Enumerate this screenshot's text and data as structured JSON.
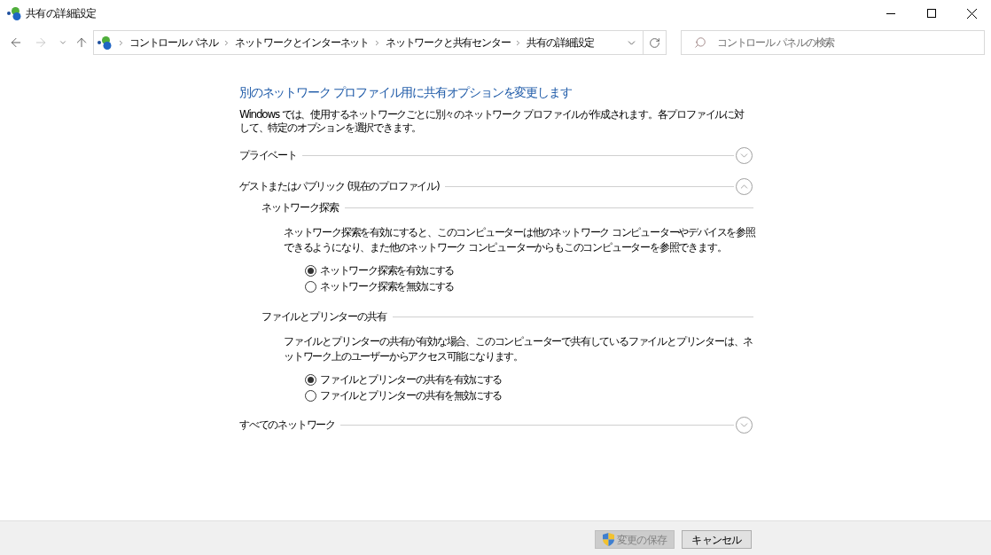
{
  "window": {
    "title": "共有の詳細設定"
  },
  "navigation": {
    "back_disabled": false,
    "forward_disabled": true
  },
  "address_bar": {
    "breadcrumbs": [
      "コントロール パネル",
      "ネットワークとインターネット",
      "ネットワークと共有センター",
      "共有の詳細設定"
    ]
  },
  "search": {
    "placeholder": "コントロール パネルの検索"
  },
  "page": {
    "heading": "別のネットワーク プロファイル用に共有オプションを変更します",
    "description": "Windows では、使用するネットワークごとに別々のネットワーク プロファイルが作成されます。各プロファイルに対して、特定のオプションを選択できます。"
  },
  "profiles": [
    {
      "label": "プライベート",
      "expanded": false
    },
    {
      "label": "ゲストまたはパブリック (現在のプロファイル)",
      "expanded": true,
      "settings": [
        {
          "title": "ネットワーク探索",
          "description": "ネットワーク探索を有効にすると、このコンピューターは他のネットワーク コンピューターやデバイスを参照できるようになり、また他のネットワーク コンピューターからもこのコンピューターを参照できます。",
          "options": [
            {
              "label": "ネットワーク探索を有効にする",
              "selected": true
            },
            {
              "label": "ネットワーク探索を無効にする",
              "selected": false
            }
          ]
        },
        {
          "title": "ファイルとプリンターの共有",
          "description": "ファイルとプリンターの共有が有効な場合、このコンピューターで共有しているファイルとプリンターは、ネットワーク上のユーザーからアクセス可能になります。",
          "options": [
            {
              "label": "ファイルとプリンターの共有を有効にする",
              "selected": true
            },
            {
              "label": "ファイルとプリンターの共有を無効にする",
              "selected": false
            }
          ]
        }
      ]
    },
    {
      "label": "すべてのネットワーク",
      "expanded": false
    }
  ],
  "buttons": [
    {
      "label": "変更の保存",
      "kind": "elevated",
      "disabled": true
    },
    {
      "label": "キャンセル",
      "kind": "plain",
      "disabled": false
    }
  ]
}
